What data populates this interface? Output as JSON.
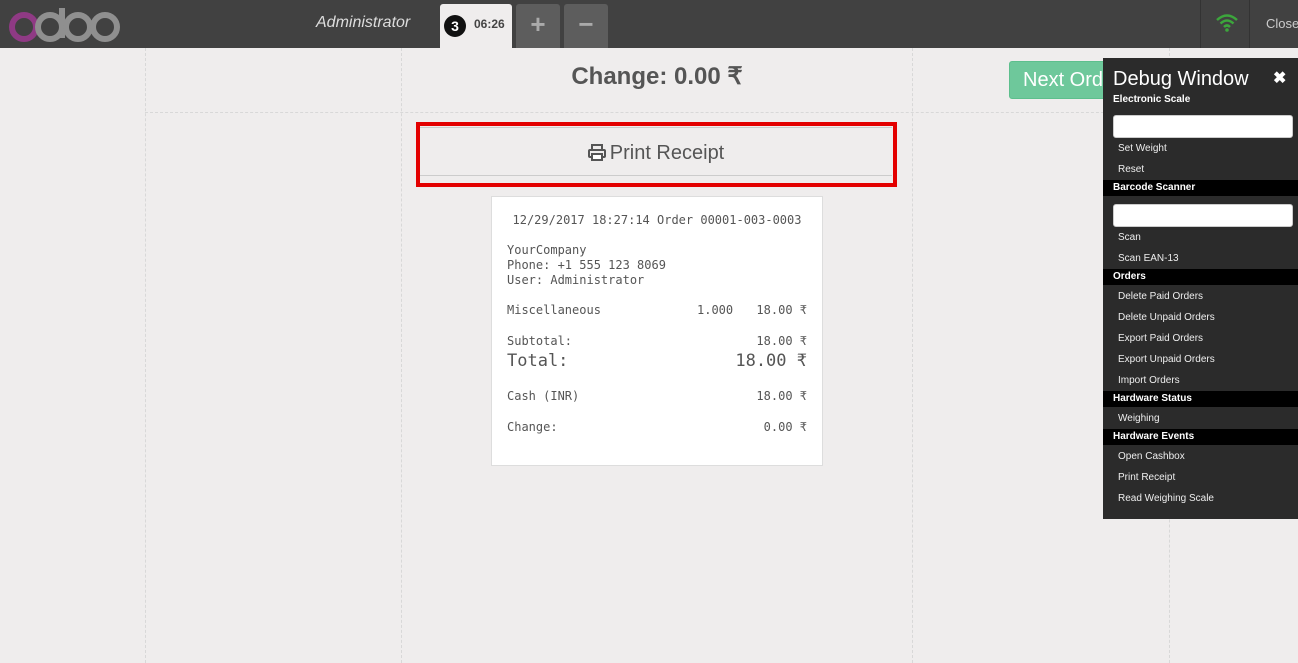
{
  "header": {
    "logo_text": "odoo",
    "user": "Administrator",
    "order_number": "3",
    "order_time": "06:26",
    "add_label": "+",
    "remove_label": "−",
    "close_label": "Close",
    "wifi_color": "#3ca63c"
  },
  "payment": {
    "change_title": "Change: 0.00 ₹",
    "next_order_label": "Next Order",
    "print_label": "Print Receipt"
  },
  "receipt": {
    "header_line": "12/29/2017 18:27:14 Order 00001-003-0003",
    "company": "YourCompany",
    "phone": "Phone: +1 555 123 8069",
    "user": "User: Administrator",
    "lines": [
      {
        "product": "Miscellaneous",
        "qty": "1.000",
        "price": "18.00 ₹"
      }
    ],
    "subtotal_label": "Subtotal:",
    "subtotal_value": "18.00 ₹",
    "total_label": "Total:",
    "total_value": "18.00 ₹",
    "payment_label": "Cash (INR)",
    "payment_value": "18.00 ₹",
    "change_label": "Change:",
    "change_value": "0.00 ₹"
  },
  "debug": {
    "title": "Debug Window",
    "sections": {
      "scale": "Electronic Scale",
      "barcode": "Barcode Scanner",
      "orders": "Orders",
      "hw_status": "Hardware Status",
      "hw_events": "Hardware Events"
    },
    "items": {
      "set_weight": "Set Weight",
      "reset": "Reset",
      "scan": "Scan",
      "scan_ean": "Scan EAN-13",
      "delete_paid": "Delete Paid Orders",
      "delete_unpaid": "Delete Unpaid Orders",
      "export_paid": "Export Paid Orders",
      "export_unpaid": "Export Unpaid Orders",
      "import": "Import Orders",
      "weighing": "Weighing",
      "open_cashbox": "Open Cashbox",
      "print_receipt": "Print Receipt",
      "read_scale": "Read Weighing Scale"
    }
  }
}
